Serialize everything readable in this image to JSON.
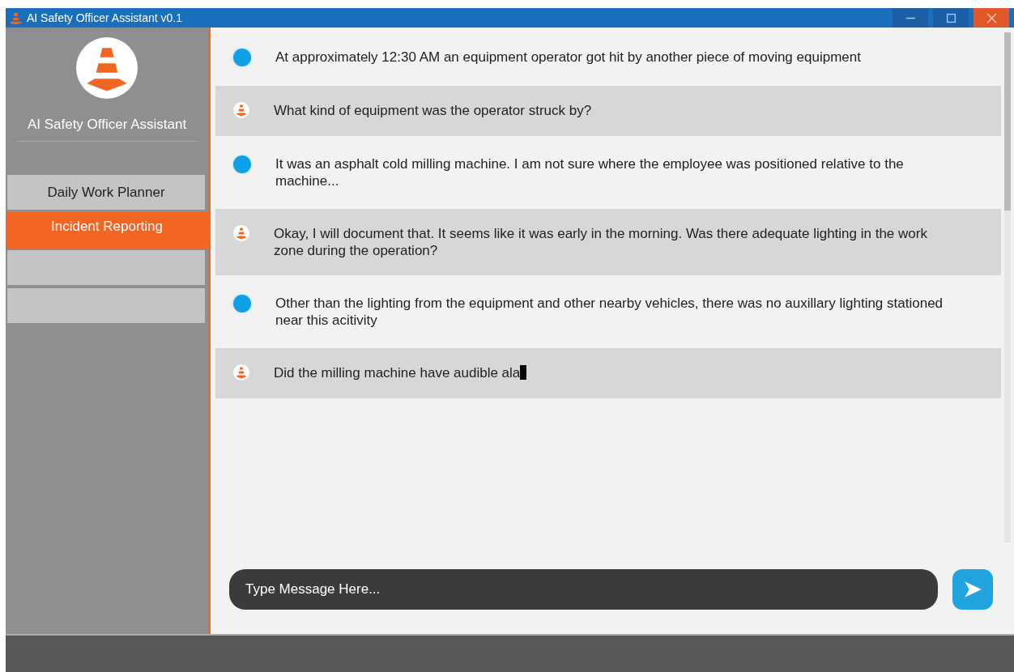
{
  "window": {
    "title": "AI Safety Officer Assistant v0.1"
  },
  "sidebar": {
    "app_name": "AI Safety Officer Assistant",
    "items": [
      {
        "label": "Daily Work Planner",
        "selected": false
      },
      {
        "label": "Incident Reporting",
        "selected": true
      },
      {
        "selected": false
      },
      {
        "selected": false
      }
    ]
  },
  "messages": [
    {
      "kind": "user",
      "text": "At approximately 12:30 AM an equipment operator got hit by another piece of moving equipment",
      "typing": false
    },
    {
      "kind": "assistant",
      "text": "What kind of equipment was the operator struck by?",
      "typing": false
    },
    {
      "kind": "user",
      "text": "It was an asphalt cold milling machine. I am not sure where the employee was positioned relative to the machine...",
      "typing": false
    },
    {
      "kind": "assistant",
      "text": "Okay, I will document that. It seems like it was early in the morning. Was there adequate lighting in the work zone during the operation?",
      "typing": false
    },
    {
      "kind": "user",
      "text": "Other than the lighting from the equipment and other nearby vehicles, there was no auxillary lighting stationed near this acitivity",
      "typing": false
    },
    {
      "kind": "assistant",
      "text": "Did the milling machine have audible ala",
      "typing": true
    }
  ],
  "composer": {
    "placeholder": "Type Message Here..."
  }
}
